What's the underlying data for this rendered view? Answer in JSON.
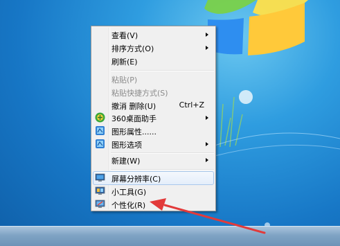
{
  "menu": {
    "view_label": "查看(V)",
    "sort_label": "排序方式(O)",
    "refresh_label": "刷新(E)",
    "paste_label": "粘贴(P)",
    "paste_shortcut_label": "粘贴快捷方式(S)",
    "undo_label": "撤消 删除(U)",
    "undo_shortcut": "Ctrl+Z",
    "desktop360_label": "360桌面助手",
    "graphics_properties_label": "图形属性......",
    "graphics_options_label": "图形选项",
    "new_label": "新建(W)",
    "screen_resolution_label": "屏幕分辨率(C)",
    "gadgets_label": "小工具(G)",
    "personalize_label": "个性化(R)"
  },
  "icons": {
    "desktop360": "360-desktop-icon",
    "graphics_properties": "intel-graphics-icon",
    "graphics_options": "intel-graphics-icon",
    "screen_resolution": "monitor-icon",
    "gadgets": "gadgets-icon",
    "personalize": "personalize-icon"
  },
  "colors": {
    "desktop_blue": "#1777c6",
    "menu_bg": "#f0f0f0",
    "highlight_border": "#a8c8ec",
    "annotation_arrow": "#e23a3a"
  }
}
